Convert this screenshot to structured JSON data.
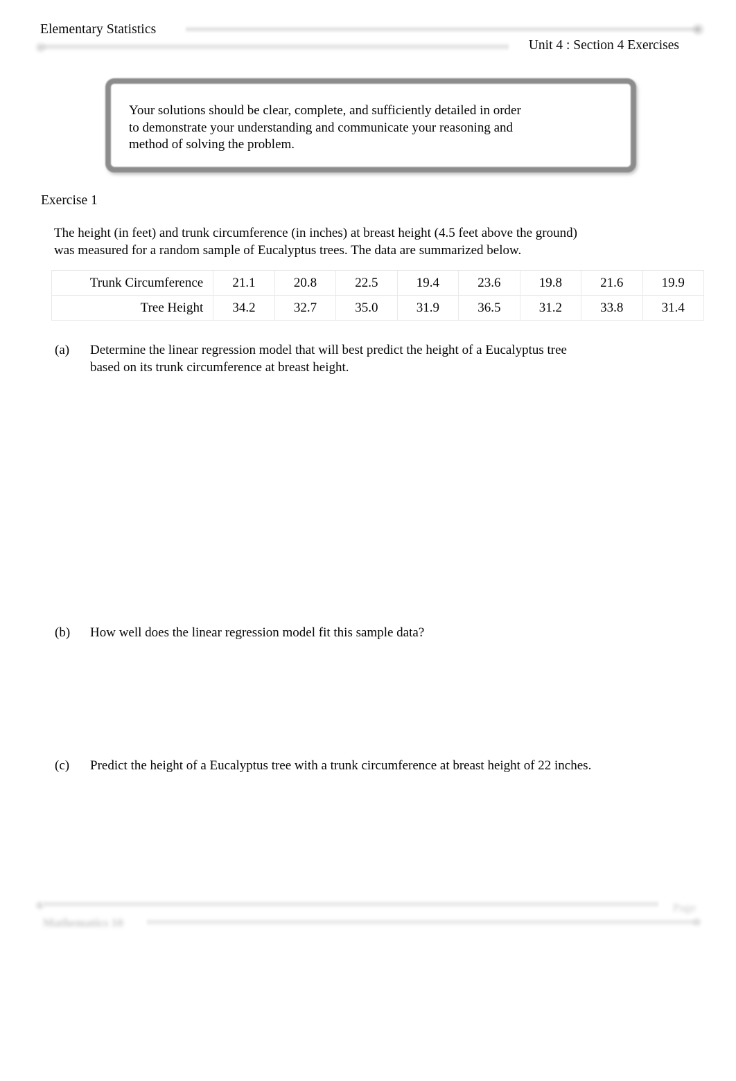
{
  "header": {
    "course_title": "Elementary Statistics",
    "unit_title": "Unit 4 : Section 4 Exercises"
  },
  "instruction_box": {
    "line1": "Your solutions should be clear, complete, and sufficiently detailed in order",
    "line2": "to demonstrate your understanding and communicate your reasoning and",
    "line3": "method of solving the problem."
  },
  "exercise": {
    "label": "Exercise 1",
    "prompt_line1": "The height (in feet) and trunk circumference (in inches) at breast height (4.5 feet above the ground)",
    "prompt_line2": "was measured for a random sample of Eucalyptus trees. The data are summarized below.",
    "table": {
      "rows": [
        {
          "label": "Trunk Circumference",
          "values": [
            "21.1",
            "20.8",
            "22.5",
            "19.4",
            "23.6",
            "19.8",
            "21.6",
            "19.9"
          ]
        },
        {
          "label": "Tree Height",
          "values": [
            "34.2",
            "32.7",
            "35.0",
            "31.9",
            "36.5",
            "31.2",
            "33.8",
            "31.4"
          ]
        }
      ]
    },
    "parts": [
      {
        "marker": "(a)",
        "line1": "Determine the linear regression model that will best predict the height of a Eucalyptus tree",
        "line2": "based on its trunk circumference at breast height."
      },
      {
        "marker": "(b)",
        "line1": "How well does the linear regression model fit this sample data?",
        "line2": ""
      },
      {
        "marker": "(c)",
        "line1": "Predict the height of a Eucalyptus tree with a trunk circumference at breast height of 22 inches.",
        "line2": ""
      }
    ]
  },
  "footer": {
    "course_label": "Mathematics 10",
    "page_label": "Page"
  },
  "colors": {
    "text": "#060606",
    "box_border": "#8c8c8c",
    "table_gridline": "#e9e9e9",
    "page_background": "#ffffff"
  }
}
